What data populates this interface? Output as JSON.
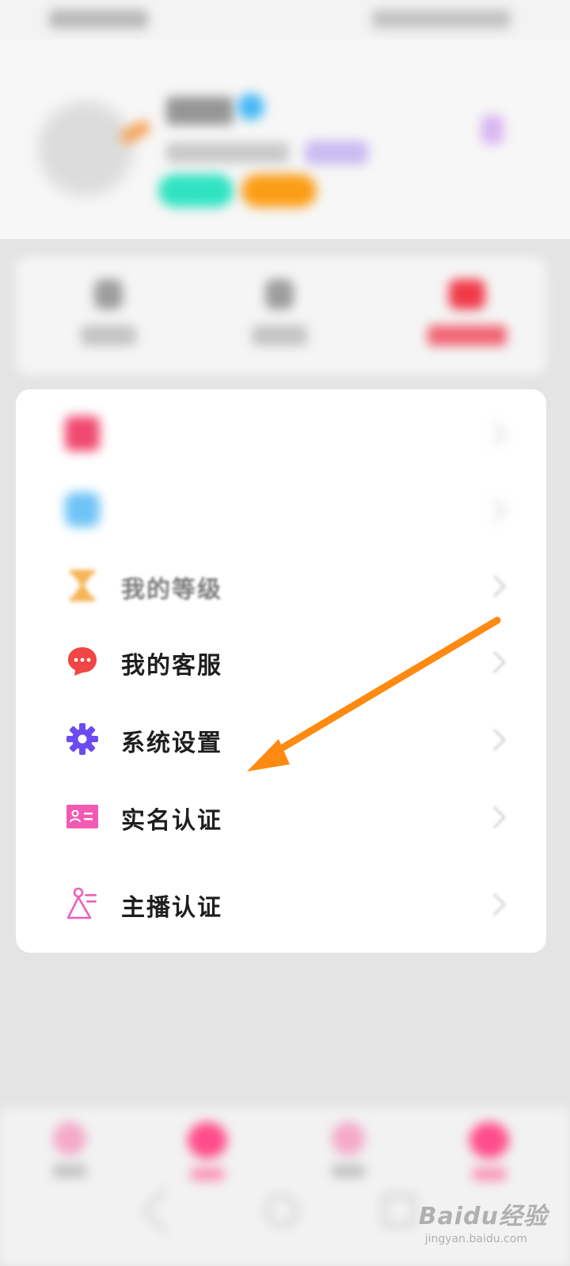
{
  "status_bar": {
    "left_icons": "signal-wifi-icons",
    "right_icons": "battery-time-icons"
  },
  "profile": {
    "avatar_icon": "avatar-image",
    "edit_icon": "pencil-icon",
    "verified_icon": "verified-badge-icon",
    "gender_icon": "gender-icon",
    "chevron_icon": "chevron-right-icon"
  },
  "stats": [
    {
      "id": "stat-1"
    },
    {
      "id": "stat-2"
    },
    {
      "id": "stat-vip",
      "accent": "#f03a48"
    }
  ],
  "menu": {
    "items": [
      {
        "label": "",
        "icon": "photo-album-icon",
        "color": "#f0486f",
        "blurred": true
      },
      {
        "label": "",
        "icon": "vip-card-icon",
        "color": "#6ec3f6",
        "blurred": true
      },
      {
        "label": "我的等级",
        "icon": "hourglass-icon",
        "color": "#f6b456",
        "blurred": true
      },
      {
        "label": "我的客服",
        "icon": "chat-bubble-icon",
        "color": "#f24545",
        "blurred": false
      },
      {
        "label": "系统设置",
        "icon": "gear-icon",
        "color": "#6c4cf0",
        "blurred": false
      },
      {
        "label": "实名认证",
        "icon": "id-card-icon",
        "color": "#f25ab2",
        "blurred": false
      },
      {
        "label": "主播认证",
        "icon": "streamer-icon",
        "color": "#ee5fb6",
        "blurred": false
      }
    ]
  },
  "annotation": {
    "arrow_color": "#ff8a12",
    "points_to": "系统设置"
  },
  "bottom_nav": {
    "items": [
      {
        "icon": "home-icon",
        "active": false
      },
      {
        "icon": "live-icon",
        "active": true
      },
      {
        "icon": "message-icon",
        "active": false
      },
      {
        "icon": "profile-icon",
        "active": true
      }
    ]
  },
  "system_nav": [
    "back-icon",
    "home-circle-icon",
    "recent-apps-icon"
  ],
  "watermark": {
    "brand": "Baidu经验",
    "site": "jingyan.baidu.com"
  }
}
